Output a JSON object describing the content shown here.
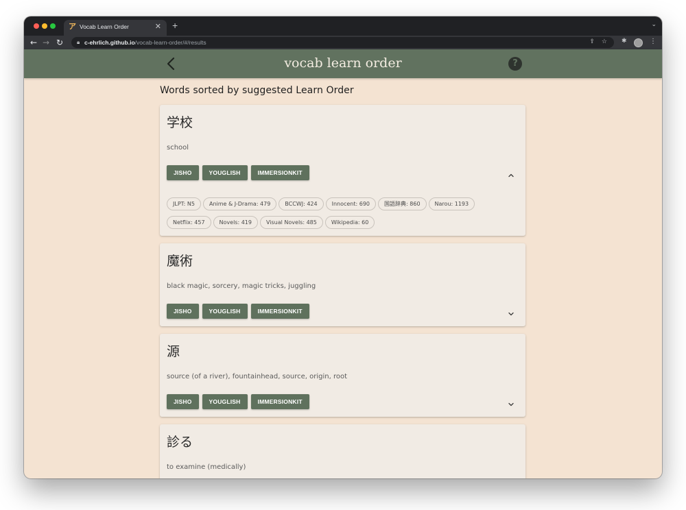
{
  "browser": {
    "tab_title": "Vocab Learn Order",
    "url_host": "c-ehrlich.github.io",
    "url_path": "/vocab-learn-order/#/results"
  },
  "app": {
    "title": "vocab learn order"
  },
  "results": {
    "heading": "Words sorted by suggested Learn Order",
    "button_labels": [
      "JISHO",
      "YOUGLISH",
      "IMMERSIONKIT"
    ],
    "cards": [
      {
        "word": "学校",
        "meaning": "school",
        "expanded": true,
        "stats": [
          "JLPT: N5",
          "Anime & J-Drama: 479",
          "BCCWJ: 424",
          "Innocent: 690",
          "国語辞典: 860",
          "Narou: 1193",
          "Netflix: 457",
          "Novels: 419",
          "Visual Novels: 485",
          "Wikipedia: 60"
        ]
      },
      {
        "word": "魔術",
        "meaning": "black magic, sorcery, magic tricks, juggling",
        "expanded": false
      },
      {
        "word": "源",
        "meaning": "source (of a river), fountainhead, source, origin, root",
        "expanded": false
      },
      {
        "word": "診る",
        "meaning": "to examine (medically)",
        "expanded": false
      }
    ]
  },
  "colors": {
    "header_green": "#61725f",
    "button_green": "#5f715d",
    "page_background": "#f4e3d2",
    "card_background": "#f1ebe4"
  },
  "icons": [
    "chevron-left-icon",
    "help-icon",
    "chevron-up-icon",
    "chevron-down-icon"
  ]
}
